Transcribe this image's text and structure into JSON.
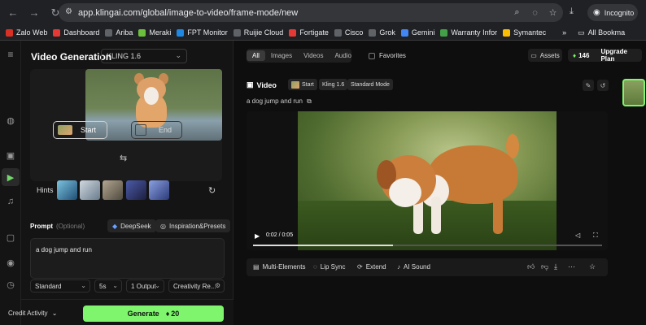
{
  "browser": {
    "url": "app.klingai.com/global/image-to-video/frame-mode/new",
    "incognito_label": "Incognito",
    "bookmarks": [
      {
        "label": "Zalo Web",
        "color": "#d93025"
      },
      {
        "label": "Dashboard",
        "color": "#e53935"
      },
      {
        "label": "Ariba",
        "color": "#5f6368"
      },
      {
        "label": "Meraki",
        "color": "#6bbf3c"
      },
      {
        "label": "FPT Monitor",
        "color": "#1e88e5"
      },
      {
        "label": "Ruijie Cloud",
        "color": "#5f6368"
      },
      {
        "label": "Fortigate",
        "color": "#e53935"
      },
      {
        "label": "Cisco",
        "color": "#5f6368"
      },
      {
        "label": "Grok",
        "color": "#5f6368"
      },
      {
        "label": "Gemini",
        "color": "#4285f4"
      },
      {
        "label": "Warranty Infor",
        "color": "#43a047"
      },
      {
        "label": "Symantec",
        "color": "#fbbc04"
      }
    ],
    "all_bookmarks_label": "All Bookma"
  },
  "left_panel": {
    "title": "Video Generation",
    "model": "KLING 1.6",
    "start_label": "Start",
    "end_label": "End",
    "hints_label": "Hints",
    "prompt_label": "Prompt",
    "prompt_optional": "(Optional)",
    "deepseek_label": "DeepSeek",
    "inspiration_label": "Inspiration&Presets",
    "prompt_text": "a dog jump and run",
    "mode_select": "Standard",
    "duration_select": "5s",
    "output_select": "1 Output",
    "creativity_select": "Creativity Re...",
    "credit_activity": "Credit Activity",
    "generate_label": "Generate",
    "generate_cost": "20"
  },
  "right_panel": {
    "tabs": [
      "All",
      "Images",
      "Videos",
      "Audio"
    ],
    "favorites_label": "Favorites",
    "assets_label": "Assets",
    "credits": "146",
    "upgrade_label": "Upgrade Plan",
    "video_heading": "Video",
    "tag_start": "Start",
    "tag_model": "Kling 1.6",
    "tag_mode": "Standard Mode",
    "caption": "a dog jump and run",
    "time": "0:02 / 0:05",
    "progress": 0.4,
    "actions": [
      "Multi-Elements",
      "Lip Sync",
      "Extend",
      "AI Sound"
    ]
  },
  "colors": {
    "accent_green": "#7ef56c"
  }
}
